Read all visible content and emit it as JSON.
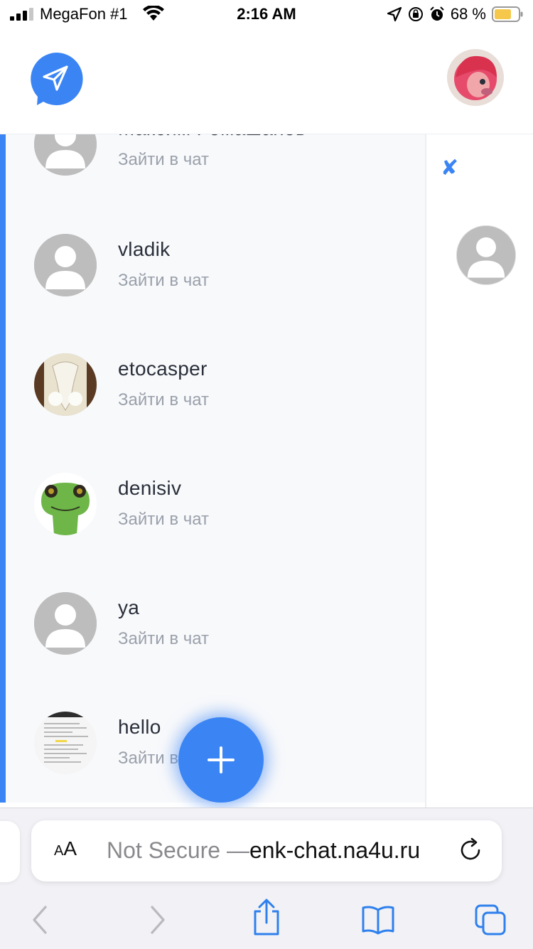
{
  "status_bar": {
    "carrier": "MegaFon #1",
    "time": "2:16 AM",
    "battery_percent": "68 %",
    "battery_color": "#f5c84c"
  },
  "header": {
    "logo_icon": "send-icon",
    "accent_color": "#3a84f4"
  },
  "chats": [
    {
      "name": "Максим Ромашанов",
      "subtitle": "Зайти в чат",
      "avatar": "default-avatar"
    },
    {
      "name": "vladik",
      "subtitle": "Зайти в чат",
      "avatar": "default-avatar"
    },
    {
      "name": "etocasper",
      "subtitle": "Зайти в чат",
      "avatar": "photo-skull"
    },
    {
      "name": "denisiv",
      "subtitle": "Зайти в чат",
      "avatar": "photo-gecko"
    },
    {
      "name": "ya",
      "subtitle": "Зайти в чат",
      "avatar": "default-avatar"
    },
    {
      "name": "hello",
      "subtitle": "Зайти в чат",
      "avatar": "photo-screenshot"
    }
  ],
  "fab": {
    "icon": "plus-icon"
  },
  "browser": {
    "text_size_label": "AA",
    "not_secure": "Not Secure —",
    "url": "enk-chat.na4u.ru"
  }
}
